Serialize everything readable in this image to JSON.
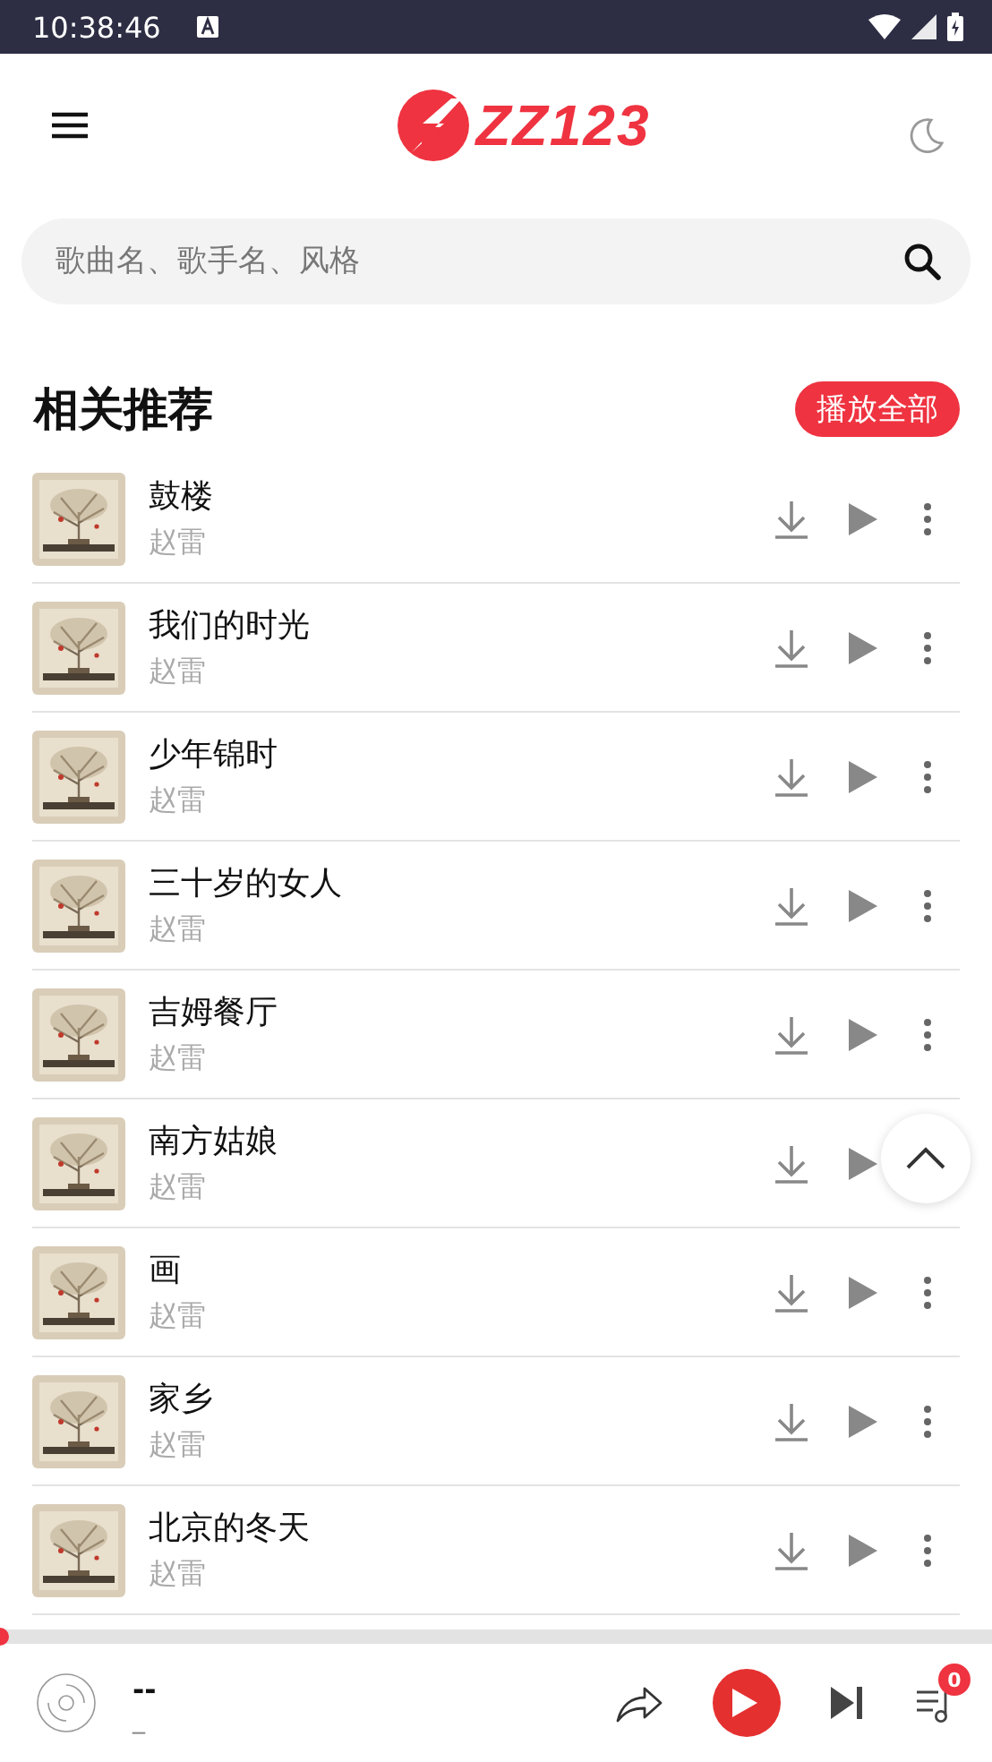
{
  "status_bar": {
    "time": "10:38:46"
  },
  "header": {
    "logo": "ZZ123"
  },
  "search": {
    "placeholder": "歌曲名、歌手名、风格"
  },
  "section": {
    "title": "相关推荐",
    "play_all": "播放全部"
  },
  "songs": [
    {
      "title": "鼓楼",
      "artist": "赵雷"
    },
    {
      "title": "我们的时光",
      "artist": "赵雷"
    },
    {
      "title": "少年锦时",
      "artist": "赵雷"
    },
    {
      "title": "三十岁的女人",
      "artist": "赵雷"
    },
    {
      "title": "吉姆餐厅",
      "artist": "赵雷"
    },
    {
      "title": "南方姑娘",
      "artist": "赵雷"
    },
    {
      "title": "画",
      "artist": "赵雷"
    },
    {
      "title": "家乡",
      "artist": "赵雷"
    },
    {
      "title": "北京的冬天",
      "artist": "赵雷"
    }
  ],
  "player": {
    "title": "--",
    "artist": "_",
    "progress": {
      "level": 0
    },
    "queue_count": "0"
  }
}
